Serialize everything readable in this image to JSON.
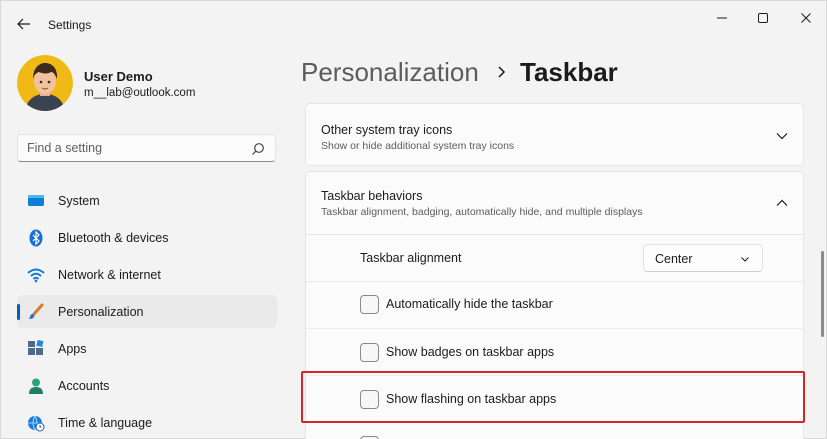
{
  "window": {
    "title": "Settings",
    "back_icon": "back-arrow-icon",
    "controls": {
      "minimize_icon": "minimize-icon",
      "maximize_icon": "maximize-icon",
      "close_icon": "close-icon"
    }
  },
  "profile": {
    "name": "User Demo",
    "email": "m__lab@outlook.com",
    "avatar_icon": "user-avatar-icon"
  },
  "search": {
    "placeholder": "Find a setting",
    "value": "",
    "icon": "search-icon"
  },
  "sidebar": {
    "items": [
      {
        "label": "System",
        "icon": "system-icon",
        "selected": false
      },
      {
        "label": "Bluetooth & devices",
        "icon": "bluetooth-icon",
        "selected": false
      },
      {
        "label": "Network & internet",
        "icon": "wifi-icon",
        "selected": false
      },
      {
        "label": "Personalization",
        "icon": "brush-icon",
        "selected": true
      },
      {
        "label": "Apps",
        "icon": "apps-icon",
        "selected": false
      },
      {
        "label": "Accounts",
        "icon": "accounts-icon",
        "selected": false
      },
      {
        "label": "Time & language",
        "icon": "globe-clock-icon",
        "selected": false
      }
    ]
  },
  "header": {
    "parent": "Personalization",
    "separator_icon": "chevron-right-icon",
    "current": "Taskbar"
  },
  "sections": {
    "other_tray": {
      "title": "Other system tray icons",
      "description": "Show or hide additional system tray icons",
      "expanded": false
    },
    "behaviors": {
      "title": "Taskbar behaviors",
      "description": "Taskbar alignment, badging, automatically hide, and multiple displays",
      "expanded": true,
      "alignment": {
        "label": "Taskbar alignment",
        "value": "Center"
      },
      "options": [
        {
          "label": "Automatically hide the taskbar",
          "checked": false
        },
        {
          "label": "Show badges on taskbar apps",
          "checked": false
        },
        {
          "label": "Show flashing on taskbar apps",
          "checked": false
        }
      ]
    }
  },
  "colors": {
    "accent": "#005fb8",
    "highlight_border": "#d6242b"
  }
}
